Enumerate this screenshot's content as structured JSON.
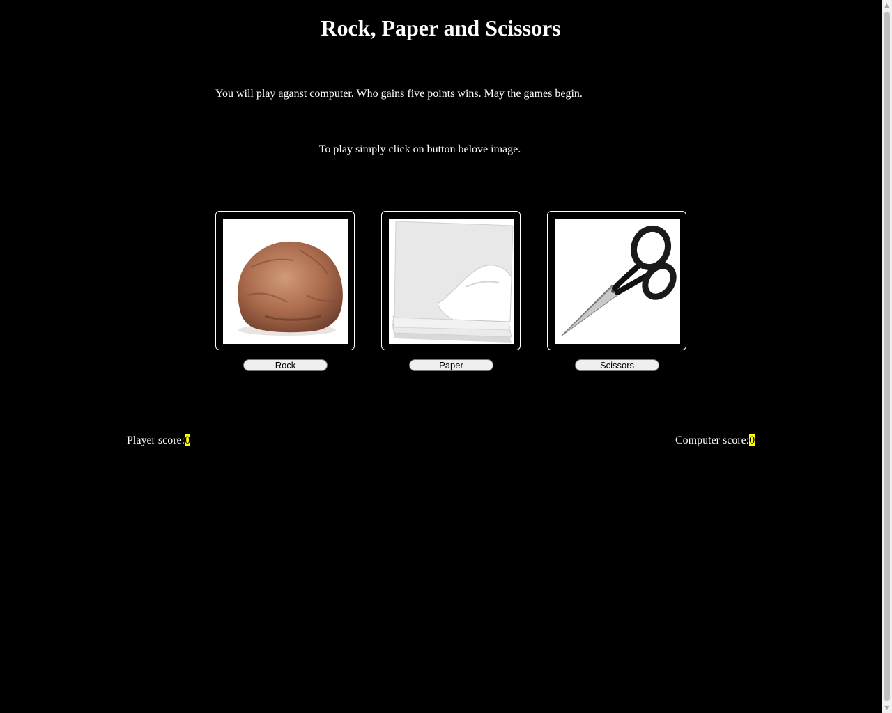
{
  "header": {
    "title": "Rock, Paper and Scissors"
  },
  "instructions": {
    "intro": "You will play aganst computer. Who gains five points wins. May the games begin.",
    "howto": "To play simply click on button belove image."
  },
  "choices": [
    {
      "label": "Rock",
      "image": "rock-image"
    },
    {
      "label": "Paper",
      "image": "paper-image"
    },
    {
      "label": "Scissors",
      "image": "scissors-image"
    }
  ],
  "scores": {
    "player_label": "Player score:",
    "player_value": "0",
    "computer_label": "Computer score:",
    "computer_value": "0",
    "highlight_color": "#ffff00"
  },
  "scrollbar": {
    "up_icon": "chevron-up-icon",
    "down_icon": "chevron-down-icon"
  }
}
